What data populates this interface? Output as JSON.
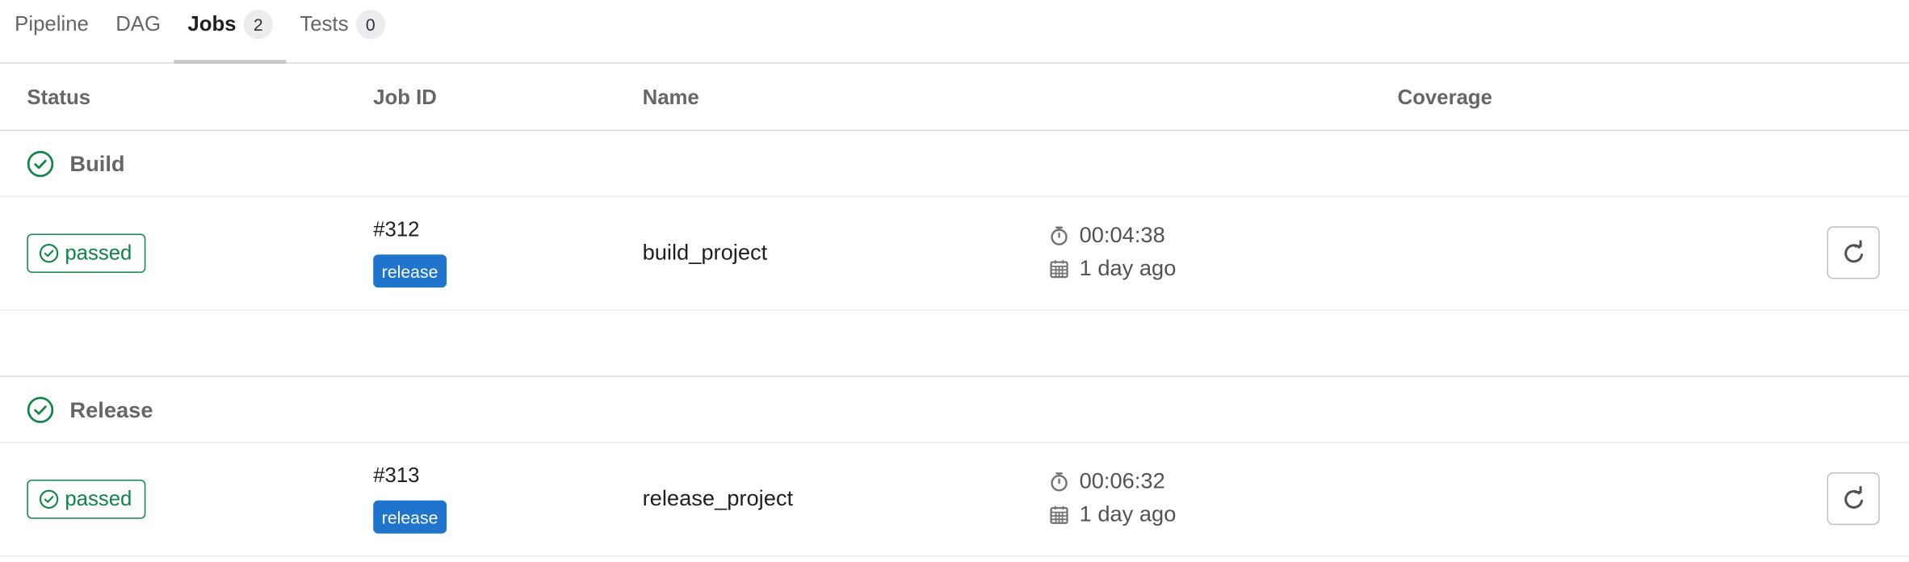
{
  "tabs": [
    {
      "label": "Pipeline"
    },
    {
      "label": "DAG"
    },
    {
      "label": "Jobs",
      "count": "2",
      "active": true
    },
    {
      "label": "Tests",
      "count": "0"
    }
  ],
  "table": {
    "columns": {
      "status": "Status",
      "job_id": "Job ID",
      "name": "Name",
      "coverage": "Coverage"
    }
  },
  "stages": [
    {
      "name": "Build",
      "status_icon": "check-circle-icon",
      "jobs": [
        {
          "status": "passed",
          "id": "#312",
          "ref": "release",
          "name": "build_project",
          "duration": "00:04:38",
          "finished": "1 day ago"
        }
      ]
    },
    {
      "name": "Release",
      "status_icon": "check-circle-icon",
      "jobs": [
        {
          "status": "passed",
          "id": "#313",
          "ref": "release",
          "name": "release_project",
          "duration": "00:06:32",
          "finished": "1 day ago"
        }
      ]
    }
  ],
  "colors": {
    "success": "#108548",
    "ref_badge": "#1f75cb",
    "active_tab_underline": "#c8c8cb"
  },
  "icons": {
    "duration": "timer-icon",
    "finished": "calendar-icon",
    "retry": "retry-icon"
  }
}
